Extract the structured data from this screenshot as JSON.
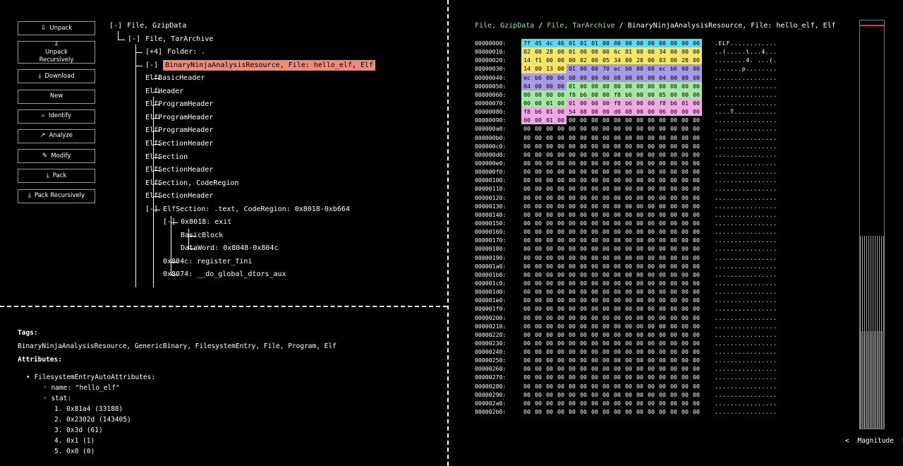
{
  "toolbar": [
    {
      "icon": "⇩",
      "label": "Unpack",
      "tall": false
    },
    {
      "icon": "⇩",
      "label": "Unpack Recursively",
      "tall": true
    },
    {
      "icon": "⤓",
      "label": "Download",
      "tall": false
    },
    {
      "icon": "",
      "label": "New",
      "tall": false
    },
    {
      "icon": "⌕",
      "label": "Identify",
      "tall": false
    },
    {
      "icon": "↗",
      "label": "Analyze",
      "tall": false
    },
    {
      "icon": "✎",
      "label": "Modify",
      "tall": false
    },
    {
      "icon": "⤓",
      "label": "Pack",
      "tall": false
    },
    {
      "icon": "⤓",
      "label": "Pack Recursively",
      "tall": false
    }
  ],
  "tree": [
    {
      "depth": 0,
      "toggle": "[-]",
      "label": "File, GzipData"
    },
    {
      "depth": 1,
      "toggle": "[-]",
      "label": "File, TarArchive"
    },
    {
      "depth": 2,
      "toggle": "[+4]",
      "label": "Folder: ."
    },
    {
      "depth": 2,
      "toggle": "[-]",
      "label": "BinaryNinjaAnalysisResource, File: hello_elf, Elf",
      "selected": true
    },
    {
      "depth": 3,
      "toggle": "",
      "label": "ElfBasicHeader"
    },
    {
      "depth": 3,
      "toggle": "",
      "label": "ElfHeader"
    },
    {
      "depth": 3,
      "toggle": "",
      "label": "ElfProgramHeader"
    },
    {
      "depth": 3,
      "toggle": "",
      "label": "ElfProgramHeader"
    },
    {
      "depth": 3,
      "toggle": "",
      "label": "ElfProgramHeader"
    },
    {
      "depth": 3,
      "toggle": "",
      "label": "ElfSectionHeader"
    },
    {
      "depth": 3,
      "toggle": "",
      "label": "ElfSection"
    },
    {
      "depth": 3,
      "toggle": "",
      "label": "ElfSectionHeader"
    },
    {
      "depth": 3,
      "toggle": "",
      "label": "ElfSection, CodeRegion"
    },
    {
      "depth": 3,
      "toggle": "",
      "label": "ElfSectionHeader"
    },
    {
      "depth": 3,
      "toggle": "[-]",
      "label": "ElfSection: .text, CodeRegion: 0x8018-0xb664"
    },
    {
      "depth": 4,
      "toggle": "[-]",
      "label": "0x8018: exit"
    },
    {
      "depth": 5,
      "toggle": "",
      "label": "BasicBlock"
    },
    {
      "depth": 5,
      "toggle": "",
      "label": "DataWord: 0x8048-0x804c"
    },
    {
      "depth": 4,
      "toggle": "",
      "label": "0x804c: register_fini"
    },
    {
      "depth": 4,
      "toggle": "",
      "label": "0x8074: __do_global_dtors_aux"
    }
  ],
  "attributes": {
    "tags_heading": "Tags:",
    "tags": "BinaryNinjaAnalysisResource, GenericBinary, FilesystemEntry, File, Program, Elf",
    "attributes_heading": "Attributes:",
    "group": "FilesystemEntryAutoAttributes:",
    "name_line": "name: \"hello_elf\"",
    "stat_label": "stat:",
    "stat": [
      "0x81a4 (33188)",
      "0x2302d (143405)",
      "0x3d (61)",
      "0x1 (1)",
      "0x0 (0)"
    ]
  },
  "breadcrumb": [
    {
      "label": "File, GzipData",
      "green": true
    },
    {
      "label": "File, TarArchive",
      "green": true
    },
    {
      "label": "BinaryNinjaAnalysisResource, File: hello_elf, Elf",
      "green": false
    }
  ],
  "hex": {
    "rows": [
      {
        "off": "00000000:",
        "bytes": "7f 45 4c 46 01 01 01 00 00 00 00 00 00 00 00 00",
        "ascii": ".ELF............"
      },
      {
        "off": "00000010:",
        "bytes": "02 00 28 00 01 00 00 00 6c 81 00 00 34 00 00 00",
        "ascii": "..(.....l...4..."
      },
      {
        "off": "00000020:",
        "bytes": "14 f1 00 00 00 02 00 05 34 00 20 00 03 00 28 00",
        "ascii": "........4. ...(."
      },
      {
        "off": "00000030:",
        "bytes": "14 00 13 00 01 00 00 70 ec b6 00 00 ec b6 00 00",
        "ascii": ".......p........"
      },
      {
        "off": "00000040:",
        "bytes": "ec b6 00 00 08 00 00 00 08 00 00 00 04 00 00 00",
        "ascii": "................"
      },
      {
        "off": "00000050:",
        "bytes": "04 00 00 00 01 00 00 00 00 00 00 00 00 00 00 00",
        "ascii": "................"
      },
      {
        "off": "00000060:",
        "bytes": "00 00 00 00 f8 b6 00 00 f8 b6 00 00 05 00 00 00",
        "ascii": "................"
      },
      {
        "off": "00000070:",
        "bytes": "00 00 01 00 01 00 00 00 f8 b6 00 00 f8 b6 01 00",
        "ascii": "................"
      },
      {
        "off": "00000080:",
        "bytes": "f8 b6 01 00 54 08 00 00 d0 08 00 00 06 00 00 00",
        "ascii": "....T..........."
      },
      {
        "off": "00000090:",
        "bytes": "00 00 01 00 00 00 00 00 00 00 00 00 00 00 00 00",
        "ascii": "................"
      },
      {
        "off": "000000a0:",
        "bytes": "00 00 00 00 00 00 00 00 00 00 00 00 00 00 00 00",
        "ascii": "................"
      },
      {
        "off": "000000b0:",
        "bytes": "00 00 00 00 00 00 00 00 00 00 00 00 00 00 00 00",
        "ascii": "................"
      },
      {
        "off": "000000c0:",
        "bytes": "00 00 00 00 00 00 00 00 00 00 00 00 00 00 00 00",
        "ascii": "................"
      },
      {
        "off": "000000d0:",
        "bytes": "00 00 00 00 00 00 00 00 00 00 00 00 00 00 00 00",
        "ascii": "................"
      },
      {
        "off": "000000e0:",
        "bytes": "00 00 00 00 00 00 00 00 00 00 00 00 00 00 00 00",
        "ascii": "................"
      },
      {
        "off": "000000f0:",
        "bytes": "00 00 00 00 00 00 00 00 00 00 00 00 00 00 00 00",
        "ascii": "................"
      },
      {
        "off": "00000100:",
        "bytes": "00 00 00 00 00 00 00 00 00 00 00 00 00 00 00 00",
        "ascii": "................"
      },
      {
        "off": "00000110:",
        "bytes": "00 00 00 00 00 00 00 00 00 00 00 00 00 00 00 00",
        "ascii": "................"
      },
      {
        "off": "00000120:",
        "bytes": "00 00 00 00 00 00 00 00 00 00 00 00 00 00 00 00",
        "ascii": "................"
      },
      {
        "off": "00000130:",
        "bytes": "00 00 00 00 00 00 00 00 00 00 00 00 00 00 00 00",
        "ascii": "................"
      },
      {
        "off": "00000140:",
        "bytes": "00 00 00 00 00 00 00 00 00 00 00 00 00 00 00 00",
        "ascii": "................"
      },
      {
        "off": "00000150:",
        "bytes": "00 00 00 00 00 00 00 00 00 00 00 00 00 00 00 00",
        "ascii": "................"
      },
      {
        "off": "00000160:",
        "bytes": "00 00 00 00 00 00 00 00 00 00 00 00 00 00 00 00",
        "ascii": "................"
      },
      {
        "off": "00000170:",
        "bytes": "00 00 00 00 00 00 00 00 00 00 00 00 00 00 00 00",
        "ascii": "................"
      },
      {
        "off": "00000180:",
        "bytes": "00 00 00 00 00 00 00 00 00 00 00 00 00 00 00 00",
        "ascii": "................"
      },
      {
        "off": "00000190:",
        "bytes": "00 00 00 00 00 00 00 00 00 00 00 00 00 00 00 00",
        "ascii": "................"
      },
      {
        "off": "000001a0:",
        "bytes": "00 00 00 00 00 00 00 00 00 00 00 00 00 00 00 00",
        "ascii": "................"
      },
      {
        "off": "000001b0:",
        "bytes": "00 00 00 00 00 00 00 00 00 00 00 00 00 00 00 00",
        "ascii": "................"
      },
      {
        "off": "000001c0:",
        "bytes": "00 00 00 00 00 00 00 00 00 00 00 00 00 00 00 00",
        "ascii": "................"
      },
      {
        "off": "000001d0:",
        "bytes": "00 00 00 00 00 00 00 00 00 00 00 00 00 00 00 00",
        "ascii": "................"
      },
      {
        "off": "000001e0:",
        "bytes": "00 00 00 00 00 00 00 00 00 00 00 00 00 00 00 00",
        "ascii": "................"
      },
      {
        "off": "000001f0:",
        "bytes": "00 00 00 00 00 00 00 00 00 00 00 00 00 00 00 00",
        "ascii": "................"
      },
      {
        "off": "00000200:",
        "bytes": "00 00 00 00 00 00 00 00 00 00 00 00 00 00 00 00",
        "ascii": "................"
      },
      {
        "off": "00000210:",
        "bytes": "00 00 00 00 00 00 00 00 00 00 00 00 00 00 00 00",
        "ascii": "................"
      },
      {
        "off": "00000220:",
        "bytes": "00 00 00 00 00 00 00 00 00 00 00 00 00 00 00 00",
        "ascii": "................"
      },
      {
        "off": "00000230:",
        "bytes": "00 00 00 00 00 00 00 00 00 00 00 00 00 00 00 00",
        "ascii": "................"
      },
      {
        "off": "00000240:",
        "bytes": "00 00 00 00 00 00 00 00 00 00 00 00 00 00 00 00",
        "ascii": "................"
      },
      {
        "off": "00000250:",
        "bytes": "00 00 00 00 00 00 00 00 00 00 00 00 00 00 00 00",
        "ascii": "................"
      },
      {
        "off": "00000260:",
        "bytes": "00 00 00 00 00 00 00 00 00 00 00 00 00 00 00 00",
        "ascii": "................"
      },
      {
        "off": "00000270:",
        "bytes": "00 00 00 00 00 00 00 00 00 00 00 00 00 00 00 00",
        "ascii": "................"
      },
      {
        "off": "00000280:",
        "bytes": "00 00 00 00 00 00 00 00 00 00 00 00 00 00 00 00",
        "ascii": "................"
      },
      {
        "off": "00000290:",
        "bytes": "00 00 00 00 00 00 00 00 00 00 00 00 00 00 00 00",
        "ascii": "................"
      },
      {
        "off": "000002a0:",
        "bytes": "00 00 00 00 00 00 00 00 00 00 00 00 00 00 00 00",
        "ascii": "................"
      },
      {
        "off": "000002b0:",
        "bytes": "00 00 00 00 00 00 00 00 00 00 00 00 00 00 00 00",
        "ascii": "................"
      }
    ],
    "colors": {
      "cyan": "#5fd7ee",
      "yellow": "#f4e46a",
      "purple": "#a89ae6",
      "green": "#a3e8a3",
      "pink": "#f2a8e6"
    }
  },
  "magnitude": {
    "prev": "<",
    "label": "Magnitude",
    "next": ">"
  }
}
